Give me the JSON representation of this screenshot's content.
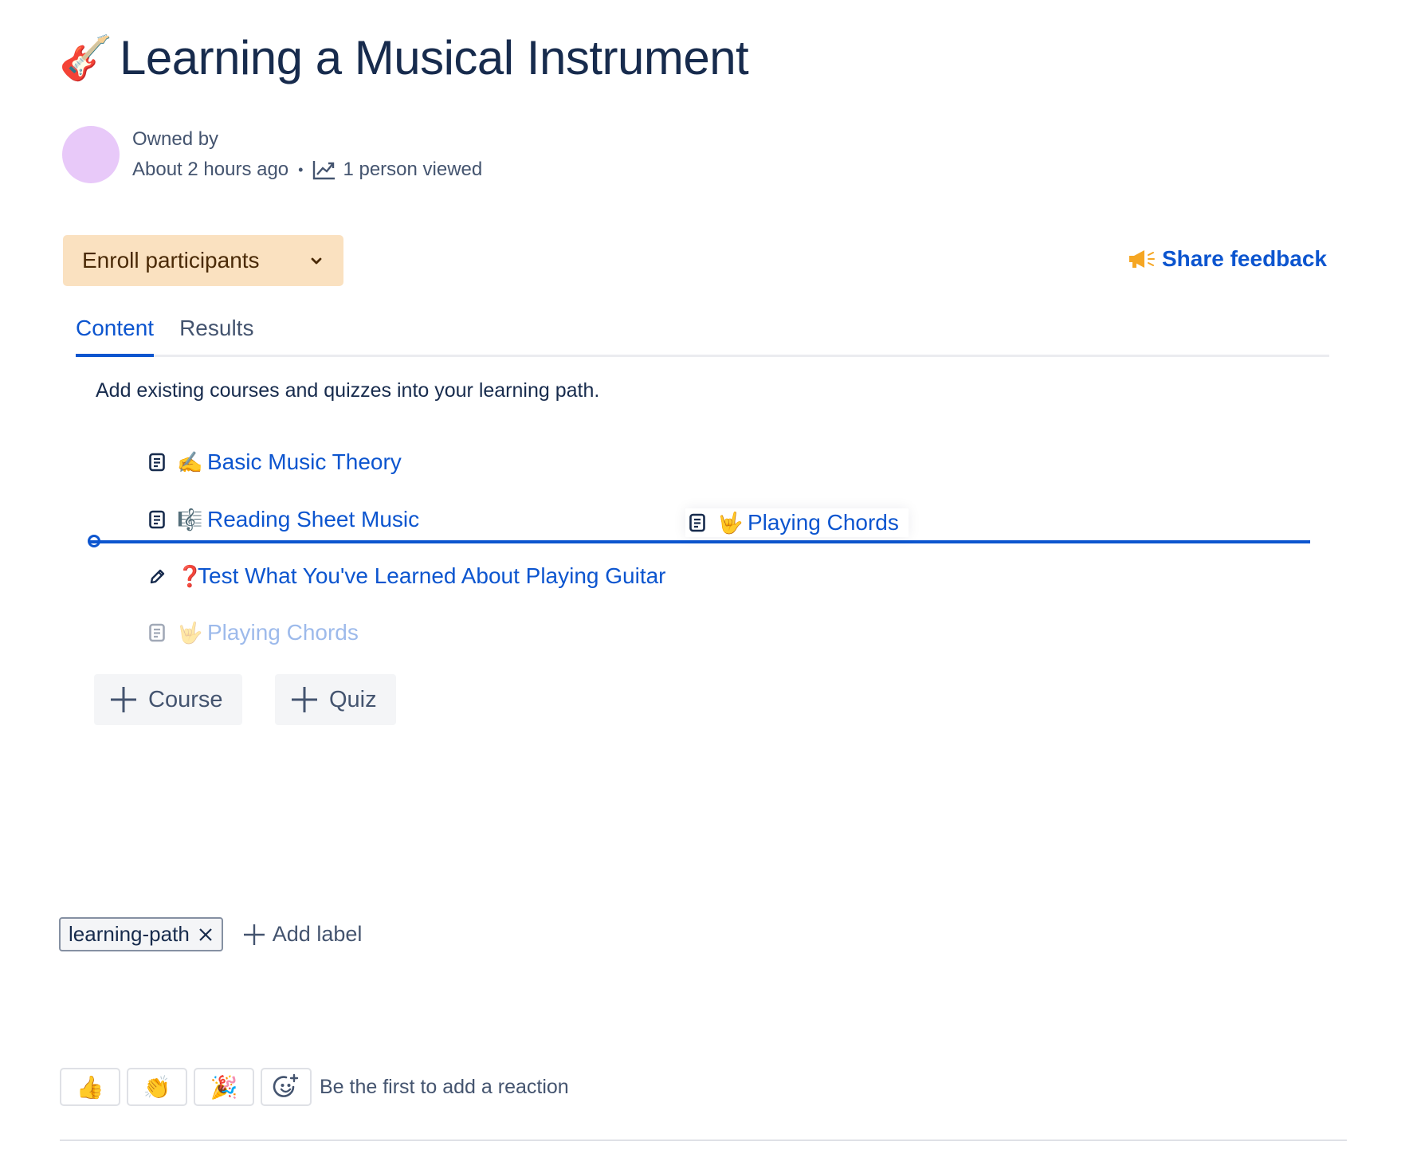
{
  "page": {
    "emoji": "🎸",
    "title": "Learning a Musical Instrument"
  },
  "byline": {
    "owned_by": "Owned by",
    "updated": "About 2 hours ago",
    "separator": "•",
    "views": "1 person viewed"
  },
  "actions": {
    "enroll_label": "Enroll participants",
    "feedback_label": "Share feedback"
  },
  "tabs": [
    {
      "label": "Content",
      "active": true
    },
    {
      "label": "Results",
      "active": false
    }
  ],
  "content": {
    "intro": "Add existing courses and quizzes into your learning path.",
    "items": [
      {
        "type": "course",
        "emoji": "✍️",
        "title": "Basic Music Theory"
      },
      {
        "type": "course",
        "emoji": "🎼",
        "title": "Reading Sheet Music"
      },
      {
        "type": "quiz",
        "emoji": "❓",
        "title": "Test What You've Learned About Playing Guitar"
      },
      {
        "type": "course",
        "emoji": "🤟",
        "title": "Playing Chords",
        "state": "dragging"
      }
    ],
    "drag_ghost": {
      "emoji": "🤟",
      "title": "Playing Chords"
    },
    "add_course_label": "Course",
    "add_quiz_label": "Quiz"
  },
  "labels": {
    "items": [
      "learning-path"
    ],
    "add_label": "Add label"
  },
  "reactions": {
    "buttons": [
      "👍",
      "👏",
      "🎉"
    ],
    "prompt": "Be the first to add a reaction"
  },
  "colors": {
    "link_blue": "#0C55CF",
    "enroll_bg": "#FAE1C0",
    "avatar": "#E8C9F9",
    "megaphone": "#F5A623"
  }
}
